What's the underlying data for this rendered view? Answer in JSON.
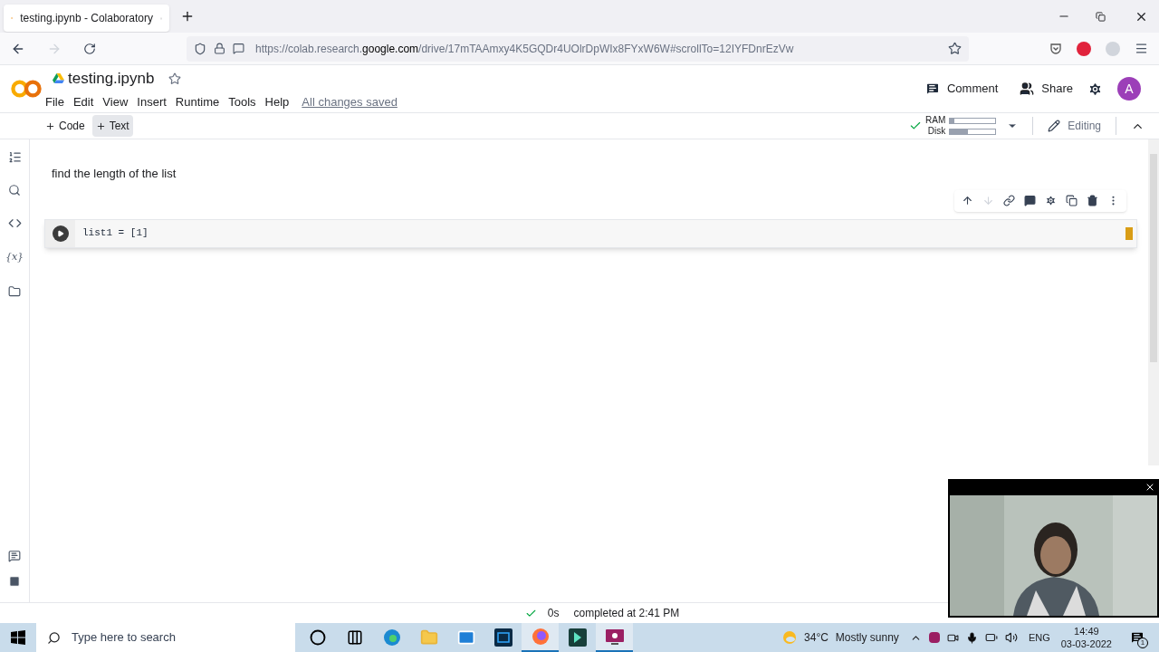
{
  "browser": {
    "tab_title": "testing.ipynb - Colaboratory",
    "url_start": "https://colab.research.",
    "url_domain": "google.com",
    "url_rest": "/drive/17mTAAmxy4K5GQDr4UOlrDpWIx8FYxW6W#scrollTo=12IYFDnrEzVw"
  },
  "notebook": {
    "title": "testing.ipynb",
    "menus": [
      "File",
      "Edit",
      "View",
      "Insert",
      "Runtime",
      "Tools",
      "Help"
    ],
    "save_status": "All changes saved",
    "comment": "Comment",
    "share": "Share",
    "avatar": "A"
  },
  "toolbar": {
    "add_code": "Code",
    "add_text": "Text",
    "add_text_hovered": true,
    "ram": {
      "label": "RAM",
      "level": 0.1
    },
    "disk": {
      "label": "Disk",
      "level": 0.4
    },
    "variables_icon": "{x}",
    "editing": "Editing"
  },
  "cells": [
    {
      "kind": "text",
      "text": "find the length of the list"
    },
    {
      "kind": "code",
      "code": "list1 = [1]"
    }
  ],
  "status_bar": {
    "duration": "0s",
    "message": "completed at 2:41 PM"
  },
  "taskbar": {
    "search_placeholder": "Type here to search",
    "apps": [
      {
        "kind": "cortana",
        "active": false
      },
      {
        "kind": "taskview",
        "active": false
      },
      {
        "kind": "edge",
        "active": false
      },
      {
        "kind": "explorer",
        "active": false
      },
      {
        "kind": "mail",
        "active": false
      },
      {
        "kind": "photoshop",
        "active": false
      },
      {
        "kind": "firefox",
        "active": true
      },
      {
        "kind": "filmora",
        "active": false
      },
      {
        "kind": "recorder",
        "active": true
      }
    ],
    "temperature": "34°C",
    "weather": "Mostly sunny",
    "language": "ENG",
    "time": "14:49",
    "date": "03-03-2022",
    "notifications": "1"
  }
}
